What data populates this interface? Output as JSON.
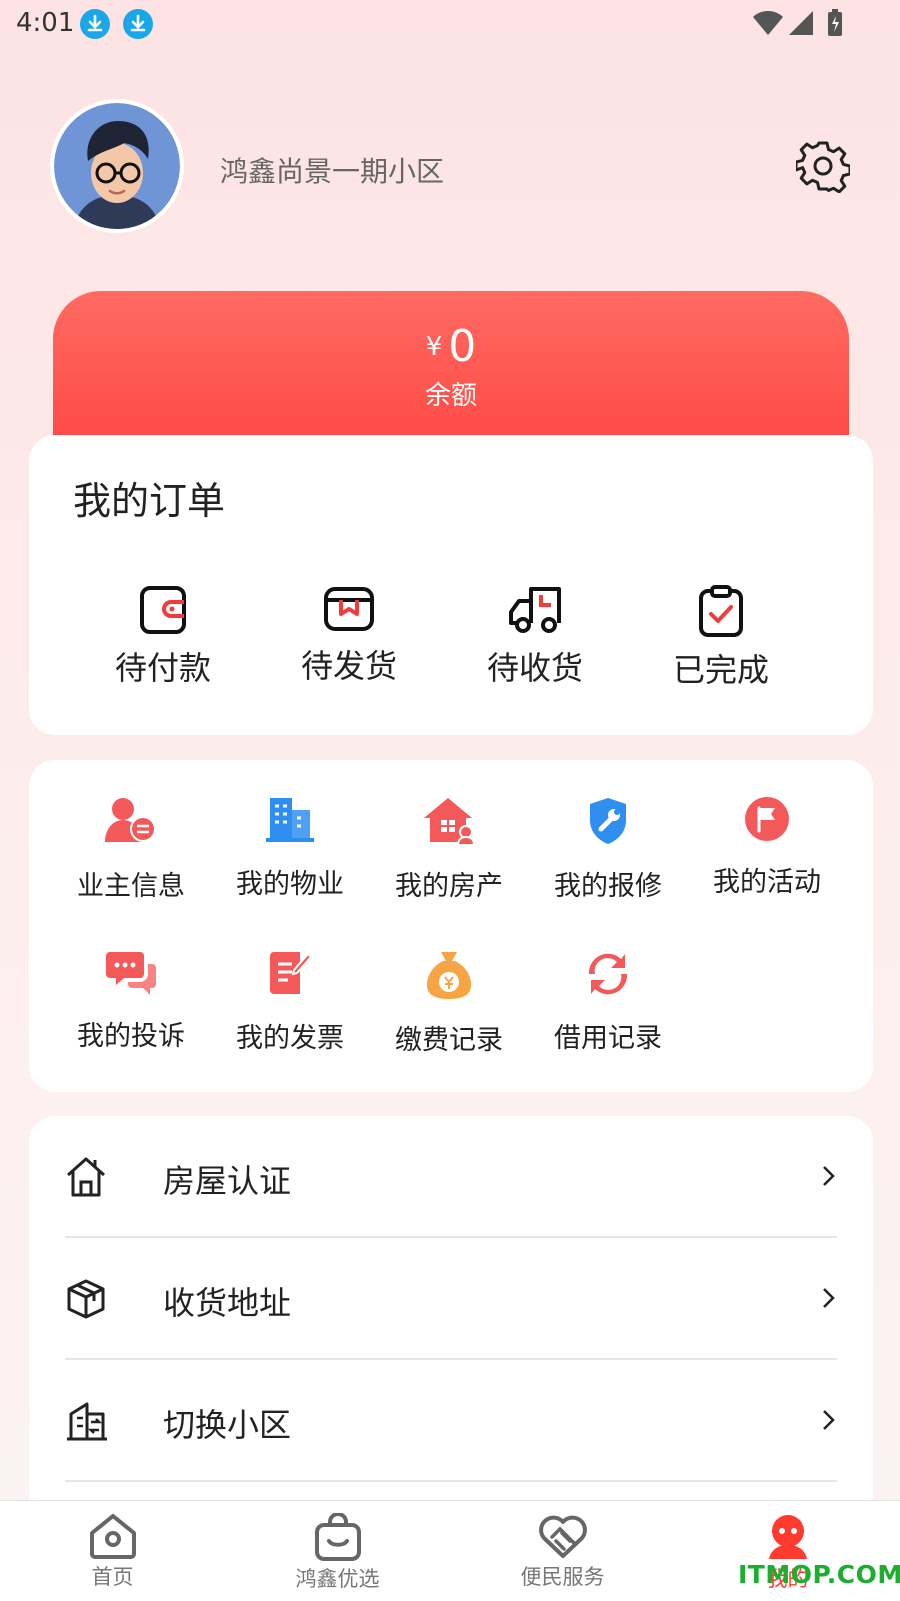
{
  "status_bar": {
    "time": "4:01"
  },
  "profile": {
    "community_name": "鸿鑫尚景一期小区"
  },
  "balance": {
    "currency": "¥",
    "amount": "0",
    "label": "余额"
  },
  "orders": {
    "title": "我的订单",
    "items": [
      {
        "label": "待付款",
        "icon": "wallet-icon"
      },
      {
        "label": "待发货",
        "icon": "package-icon"
      },
      {
        "label": "待收货",
        "icon": "truck-icon"
      },
      {
        "label": "已完成",
        "icon": "clipboard-check-icon"
      }
    ]
  },
  "services": {
    "items": [
      {
        "label": "业主信息",
        "icon": "owner-info-icon"
      },
      {
        "label": "我的物业",
        "icon": "building-icon"
      },
      {
        "label": "我的房产",
        "icon": "house-icon"
      },
      {
        "label": "我的报修",
        "icon": "repair-shield-icon"
      },
      {
        "label": "我的活动",
        "icon": "flag-icon"
      },
      {
        "label": "我的投诉",
        "icon": "chat-icon"
      },
      {
        "label": "我的发票",
        "icon": "invoice-icon"
      },
      {
        "label": "缴费记录",
        "icon": "money-bag-icon"
      },
      {
        "label": "借用记录",
        "icon": "refresh-icon"
      }
    ]
  },
  "menu": {
    "items": [
      {
        "label": "房屋认证",
        "icon": "home-outline-icon"
      },
      {
        "label": "收货地址",
        "icon": "box-icon"
      },
      {
        "label": "切换小区",
        "icon": "switch-community-icon"
      }
    ]
  },
  "tabs": [
    {
      "label": "首页",
      "icon": "home-tab-icon",
      "active": false
    },
    {
      "label": "鸿鑫优选",
      "icon": "shopping-bag-icon",
      "active": false
    },
    {
      "label": "便民服务",
      "icon": "handshake-heart-icon",
      "active": false
    },
    {
      "label": "我的",
      "icon": "profile-tab-icon",
      "active": true
    }
  ],
  "watermark": "ITMOP.COM",
  "colors": {
    "accent": "#ff3b30",
    "balance_card": "#ff5a52",
    "blue": "#2f8ff0",
    "orange": "#f7a544"
  }
}
